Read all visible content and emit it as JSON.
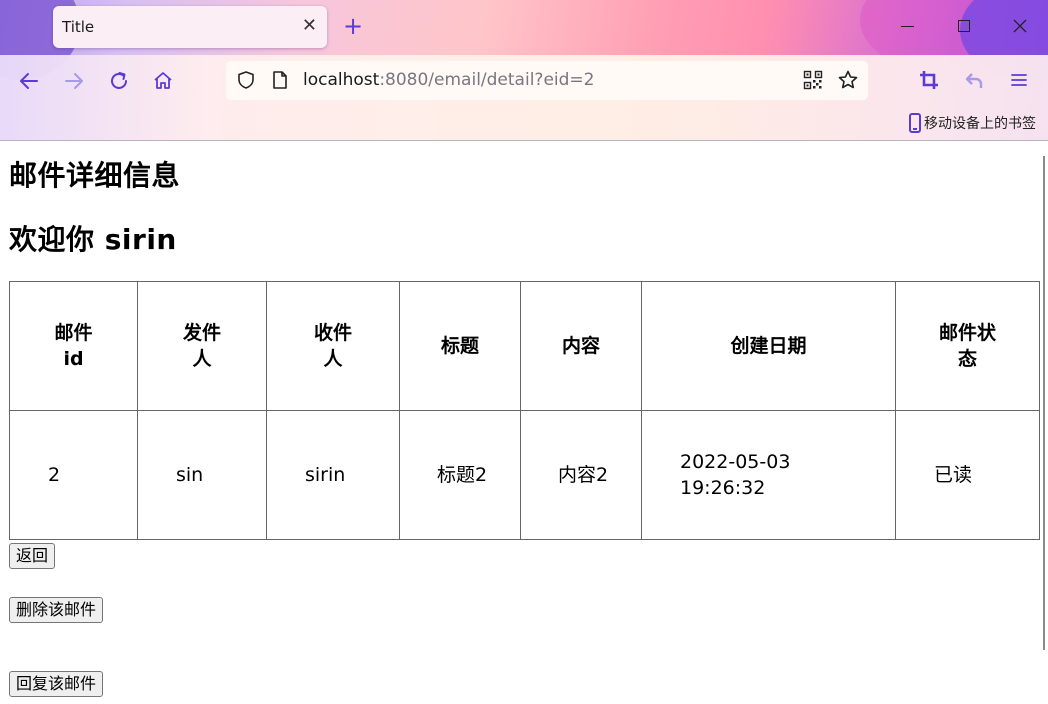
{
  "browser": {
    "tab_title": "Title",
    "tab_close_glyph": "✕",
    "new_tab_glyph": "+",
    "url_host": "localhost",
    "url_rest": ":8080/email/detail?eid=2",
    "bookmark_label": "移动设备上的书签",
    "accent_color": "#5a3bd8"
  },
  "page": {
    "heading": "邮件详细信息",
    "welcome": "欢迎你 sirin"
  },
  "table": {
    "headers": [
      "邮件id",
      "发件人",
      "收件人",
      "标题",
      "内容",
      "创建日期",
      "邮件状态"
    ],
    "rows": [
      [
        "2",
        "sin",
        "sirin",
        "标题2",
        "内容2",
        "2022-05-03 19:26:32",
        "已读"
      ]
    ]
  },
  "buttons": {
    "back": "返回",
    "delete": "删除该邮件",
    "reply": "回复该邮件"
  }
}
